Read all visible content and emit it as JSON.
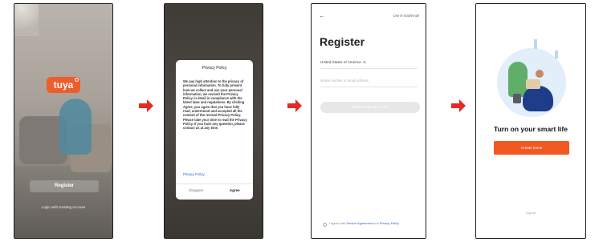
{
  "screen1": {
    "logo": "tuya",
    "register_button": "Register",
    "login_link": "Login with Existing Account"
  },
  "screen2": {
    "status_left": "",
    "status_right": "",
    "dialog": {
      "title": "Privacy Policy",
      "body": "We pay high attention to the privacy of personal information. To fully present how we collect and use your personal information, we revised the Privacy Policy in detail in compliance with the latest laws and regulations. By clicking Agree, you agree that you have fully read, understood and accepted all the content of the revised Privacy Policy. Please take your time to read the Privacy Policy. If you have any question, please contact us at any time.",
      "link": "Privacy Policy",
      "disagree": "Disagree",
      "agree": "Agree"
    }
  },
  "screen3": {
    "back_glyph": "←",
    "email_link": "Use E-mail/email",
    "title": "Register",
    "country": "United States of America +1",
    "phone_placeholder": "Mobile number or email address",
    "verify_button": "Obtain Verification Code",
    "agree_prefix": "I agree with ",
    "service_agreement": "Service Agreement",
    "agree_and": " and ",
    "privacy_policy": "Privacy Policy"
  },
  "screen4": {
    "headline": "Turn on your smart life",
    "create_button": "Create home",
    "login_text": "Log out"
  },
  "colors": {
    "accent": "#ee5d2a",
    "arrow": "#e52a24",
    "link": "#2b62c9"
  }
}
